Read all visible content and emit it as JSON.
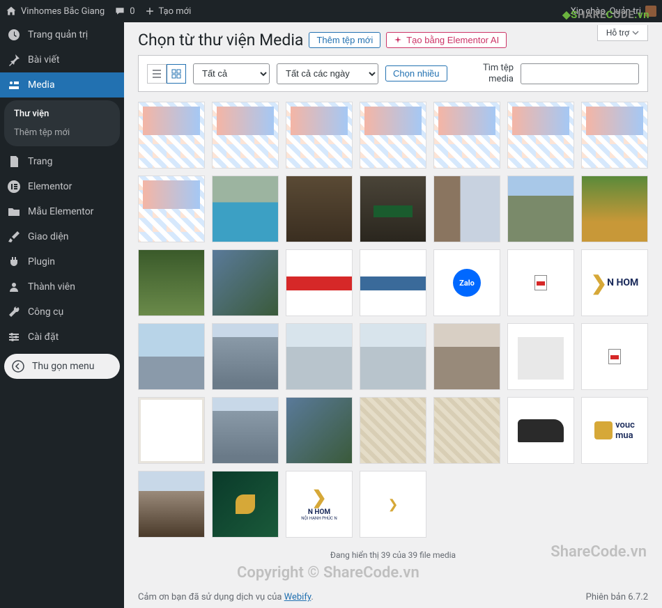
{
  "adminbar": {
    "site_name": "Vinhomes Bắc Giang",
    "comments_count": "0",
    "new_label": "Tạo mới",
    "greeting": "Xin chào, Quản trị"
  },
  "help_label": "Hỗ trợ",
  "sidebar": {
    "items": [
      {
        "label": "Trang quản trị",
        "icon": "dashboard"
      },
      {
        "label": "Bài viết",
        "icon": "pin"
      },
      {
        "label": "Media",
        "icon": "media",
        "selected": true
      },
      {
        "label": "Trang",
        "icon": "page"
      },
      {
        "label": "Elementor",
        "icon": "elementor"
      },
      {
        "label": "Mẫu Elementor",
        "icon": "folder"
      },
      {
        "label": "Giao diện",
        "icon": "brush"
      },
      {
        "label": "Plugin",
        "icon": "plug"
      },
      {
        "label": "Thành viên",
        "icon": "user"
      },
      {
        "label": "Công cụ",
        "icon": "wrench"
      },
      {
        "label": "Cài đặt",
        "icon": "settings"
      }
    ],
    "submenu": {
      "library": "Thư viện",
      "add_new": "Thêm tệp mới"
    },
    "collapse": "Thu gọn menu"
  },
  "heading": {
    "title": "Chọn từ thư viện Media",
    "add_new": "Thêm tệp mới",
    "elementor_ai": "Tạo bằng Elementor AI"
  },
  "filter": {
    "type_all": "Tất cả",
    "date_all": "Tất cả các ngày",
    "bulk_select": "Chọn nhiều",
    "search_label_1": "Tìm tệp",
    "search_label_2": "media"
  },
  "media_items": [
    {
      "kind": "floor"
    },
    {
      "kind": "floor"
    },
    {
      "kind": "floor"
    },
    {
      "kind": "floor"
    },
    {
      "kind": "floor"
    },
    {
      "kind": "floor"
    },
    {
      "kind": "floor"
    },
    {
      "kind": "floor2"
    },
    {
      "kind": "pool"
    },
    {
      "kind": "lobby"
    },
    {
      "kind": "billiard"
    },
    {
      "kind": "gym"
    },
    {
      "kind": "tower"
    },
    {
      "kind": "park"
    },
    {
      "kind": "gazebo"
    },
    {
      "kind": "aerial"
    },
    {
      "kind": "red"
    },
    {
      "kind": "blue"
    },
    {
      "kind": "zalo",
      "label": "Zalo"
    },
    {
      "kind": "pdf"
    },
    {
      "kind": "vhome",
      "text": "N HOM"
    },
    {
      "kind": "city"
    },
    {
      "kind": "hirise"
    },
    {
      "kind": "townhouse"
    },
    {
      "kind": "townhouse"
    },
    {
      "kind": "townhouse2"
    },
    {
      "kind": "whitebld"
    },
    {
      "kind": "pdf"
    },
    {
      "kind": "frame"
    },
    {
      "kind": "hirise"
    },
    {
      "kind": "aerial"
    },
    {
      "kind": "pattern"
    },
    {
      "kind": "pattern"
    },
    {
      "kind": "car"
    },
    {
      "kind": "voucher",
      "line1": "vouc",
      "line2": "mua"
    },
    {
      "kind": "render"
    },
    {
      "kind": "greenlogo"
    },
    {
      "kind": "logo-full",
      "line1": "N HOM",
      "line2": "NỘI HẠNH PHÚC N"
    },
    {
      "kind": "logo-sm"
    }
  ],
  "status": "Đang hiển thị 39 của 39 file media",
  "footer": {
    "thanks_prefix": "Cảm ơn bạn đã sử dụng dịch vụ của ",
    "thanks_link": "Webify",
    "thanks_suffix": ".",
    "version": "Phiên bản 6.7.2"
  },
  "watermark": {
    "brand": "SHARECODE.vn",
    "line1": "ShareCode.vn",
    "line2": "Copyright © ShareCode.vn"
  }
}
